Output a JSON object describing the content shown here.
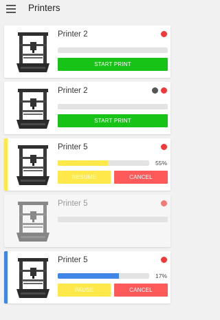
{
  "header": {
    "title": "Printers"
  },
  "colors": {
    "green": "#17c317",
    "red": "#ff5a5a",
    "yellow": "#ffe94a",
    "blue": "#3f86e6",
    "dot_red": "#f03a3a",
    "dot_grey": "#555555"
  },
  "printers": [
    {
      "name": "Printer 2",
      "status_dot": "red",
      "progress_percent": 0,
      "buttons": [
        "START PRINT"
      ]
    },
    {
      "name": "Printer 2",
      "status_dots": [
        "grey",
        "red"
      ],
      "progress_percent": 0,
      "buttons": [
        "START PRINT"
      ]
    },
    {
      "name": "Printer 5",
      "status_dot": "red",
      "accent": "yellow",
      "progress_percent": 55,
      "progress_label": "55%",
      "buttons": [
        "RESUME",
        "CANCEL"
      ]
    },
    {
      "name": "Printer 5",
      "status_dot": "red",
      "state": "disabled",
      "progress_percent": 0,
      "buttons": []
    },
    {
      "name": "Printer 5",
      "status_dot": "red",
      "accent": "blue",
      "progress_percent": 17,
      "progress_label": "17%",
      "buttons": [
        "PAUSE",
        "CANCEL"
      ]
    }
  ]
}
